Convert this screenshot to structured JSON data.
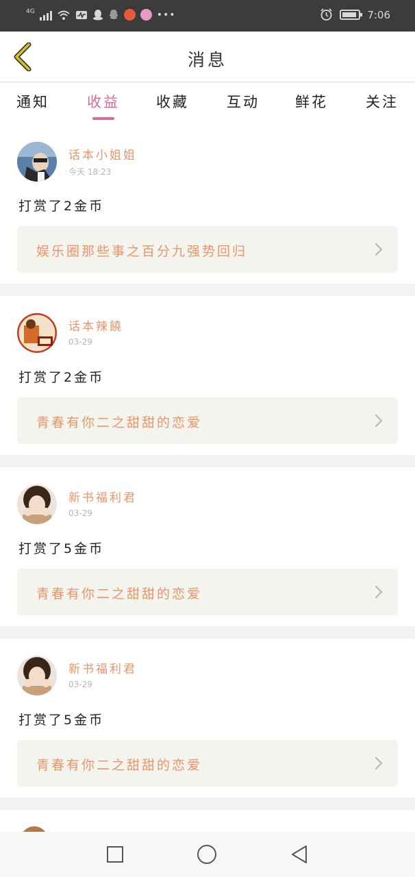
{
  "status_bar": {
    "network": "4G",
    "time": "7:06",
    "icons": [
      "signal-icon",
      "wifi-icon",
      "activity-icon",
      "qq-icon",
      "snapchat-icon",
      "weibo-icon",
      "app-icon",
      "more-icon",
      "alarm-icon",
      "battery-icon"
    ]
  },
  "header": {
    "title": "消息",
    "back_icon": "chevron-left-icon"
  },
  "tabs": [
    {
      "label": "通知",
      "active": false
    },
    {
      "label": "收益",
      "active": true
    },
    {
      "label": "收藏",
      "active": false
    },
    {
      "label": "互动",
      "active": false
    },
    {
      "label": "鲜花",
      "active": false
    },
    {
      "label": "关注",
      "active": false
    }
  ],
  "messages": [
    {
      "nickname": "话本小姐姐",
      "time": "今天 18:23",
      "text": "打赏了2金币",
      "book": "娱乐圈那些事之百分九强势回归"
    },
    {
      "nickname": "话本辣饒",
      "time": "03-29",
      "text": "打赏了2金币",
      "book": "青春有你二之甜甜的恋爱"
    },
    {
      "nickname": "新书福利君",
      "time": "03-29",
      "text": "打赏了5金币",
      "book": "青春有你二之甜甜的恋爱"
    },
    {
      "nickname": "新书福利君",
      "time": "03-29",
      "text": "打赏了5金币",
      "book": "青春有你二之甜甜的恋爱"
    }
  ],
  "colors": {
    "accent": "#d96a9a",
    "nickname": "#e8956a",
    "back_arrow": "#c9a227",
    "link_bg": "#f4f4ee"
  },
  "nav_bar": {
    "icons": [
      "recent-apps-icon",
      "home-icon",
      "back-icon"
    ]
  }
}
